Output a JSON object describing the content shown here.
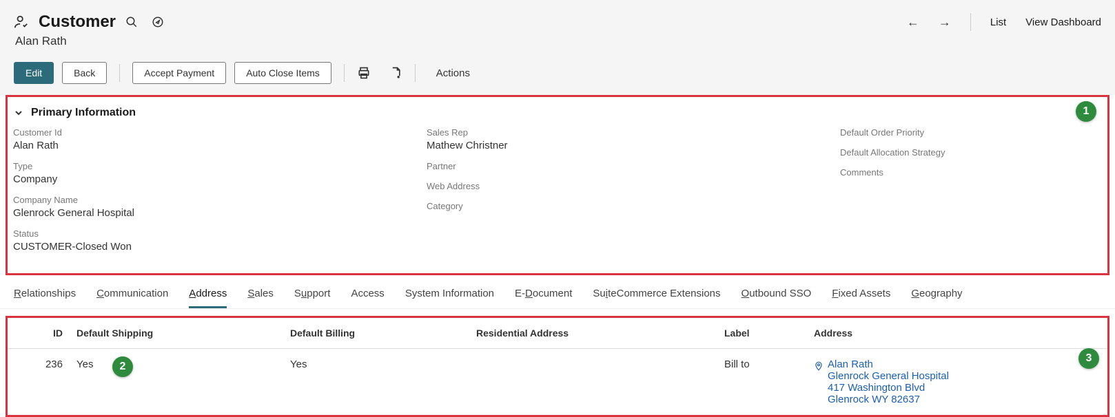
{
  "header": {
    "title": "Customer",
    "subtitle": "Alan Rath",
    "nav_list": "List",
    "nav_dashboard": "View Dashboard"
  },
  "toolbar": {
    "edit": "Edit",
    "back": "Back",
    "accept_payment": "Accept Payment",
    "auto_close": "Auto Close Items",
    "actions": "Actions"
  },
  "primary_info": {
    "section_title": "Primary Information",
    "marker": "1",
    "col1": {
      "customer_id_label": "Customer Id",
      "customer_id_value": "Alan Rath",
      "type_label": "Type",
      "type_value": "Company",
      "company_name_label": "Company Name",
      "company_name_value": "Glenrock General Hospital",
      "status_label": "Status",
      "status_value": "CUSTOMER-Closed Won"
    },
    "col2": {
      "sales_rep_label": "Sales Rep",
      "sales_rep_value": "Mathew Christner",
      "partner_label": "Partner",
      "partner_value": "",
      "web_address_label": "Web Address",
      "web_address_value": "",
      "category_label": "Category",
      "category_value": ""
    },
    "col3": {
      "default_order_priority_label": "Default Order Priority",
      "default_allocation_strategy_label": "Default Allocation Strategy",
      "comments_label": "Comments"
    }
  },
  "tabs": {
    "relationships": "Relationships",
    "communication": "Communication",
    "address": "Address",
    "sales": "Sales",
    "support": "Support",
    "access": "Access",
    "sysinfo": "System Information",
    "edoc": "E-Document",
    "suitecommerce": "SuiteCommerce Extensions",
    "outbound_sso": "Outbound SSO",
    "fixed_assets": "Fixed Assets",
    "geography": "Geography"
  },
  "address_table": {
    "marker_left": "2",
    "marker_right": "3",
    "headers": {
      "id": "ID",
      "default_shipping": "Default Shipping",
      "default_billing": "Default Billing",
      "residential": "Residential Address",
      "label": "Label",
      "address": "Address"
    },
    "row": {
      "id": "236",
      "default_shipping": "Yes",
      "default_billing": "Yes",
      "residential": "",
      "label": "Bill to",
      "addr_line1": "Alan Rath",
      "addr_line2": "Glenrock General Hospital",
      "addr_line3": "417 Washington Blvd",
      "addr_line4": "Glenrock WY 82637"
    }
  }
}
